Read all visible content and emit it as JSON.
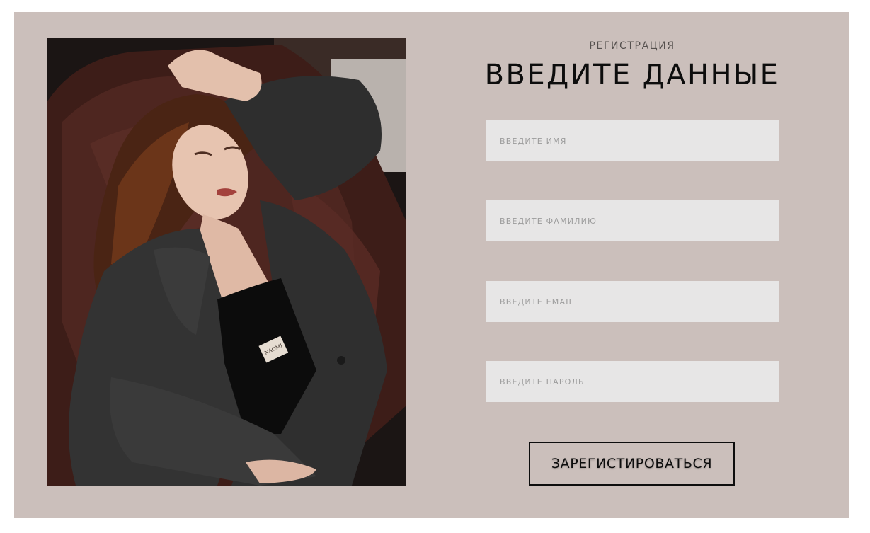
{
  "registration": {
    "eyebrow": "РЕГИСТРАЦИЯ",
    "title": "ВВЕДИТЕ ДАННЫЕ",
    "fields": [
      {
        "placeholder": "ВВЕДИТЕ ИМЯ",
        "value": ""
      },
      {
        "placeholder": "ВВЕДИТЕ ФАМИЛИЮ",
        "value": ""
      },
      {
        "placeholder": "ВВЕДИТЕ EMAIL",
        "value": ""
      },
      {
        "placeholder": "ВВЕДИТЕ ПАРОЛЬ",
        "value": ""
      }
    ],
    "submit_label": "ЗАРЕГИСТИРОВАТЬСЯ"
  },
  "photo": {
    "label_text": "NAOMI"
  },
  "colors": {
    "panel_bg": "#cbbfbb",
    "field_bg": "#e7e6e6",
    "text_dark": "#0d0d0d",
    "placeholder": "#9c9c9c"
  }
}
